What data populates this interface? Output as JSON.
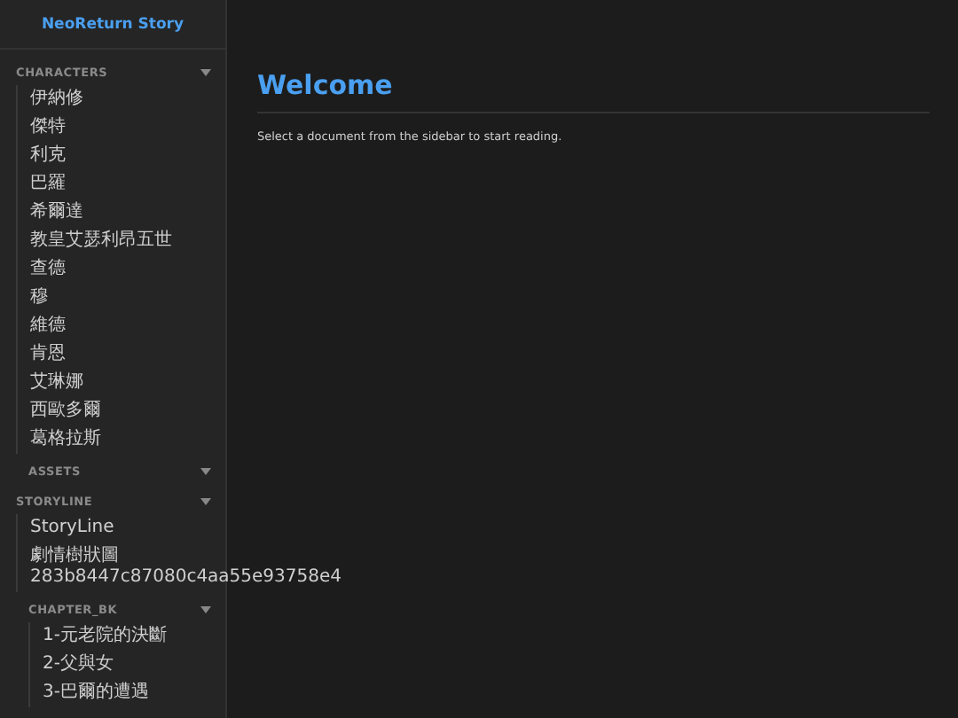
{
  "sidebar": {
    "title": "NeoReturn Story",
    "sections": [
      {
        "label": "CHARACTERS",
        "items": [
          {
            "label": "伊納修"
          },
          {
            "label": "傑特"
          },
          {
            "label": "利克"
          },
          {
            "label": "巴羅"
          },
          {
            "label": "希爾達"
          },
          {
            "label": "教皇艾瑟利昂五世"
          },
          {
            "label": "查德"
          },
          {
            "label": "穆"
          },
          {
            "label": "維德"
          },
          {
            "label": "肯恩"
          },
          {
            "label": "艾琳娜"
          },
          {
            "label": "西歐多爾"
          },
          {
            "label": "葛格拉斯"
          }
        ],
        "children": [
          {
            "label": "ASSETS"
          }
        ]
      },
      {
        "label": "STORYLINE",
        "items": [
          {
            "label": "StoryLine"
          },
          {
            "label": "劇情樹狀圖 283b8447c87080c4aa55e93758e4"
          }
        ],
        "children": [
          {
            "label": "CHAPTER_BK",
            "items": [
              {
                "label": "1-元老院的決斷"
              },
              {
                "label": "2-父與女"
              },
              {
                "label": "3-巴爾的遭遇"
              }
            ]
          }
        ]
      }
    ]
  },
  "main": {
    "heading": "Welcome",
    "text": "Select a document from the sidebar to start reading."
  }
}
